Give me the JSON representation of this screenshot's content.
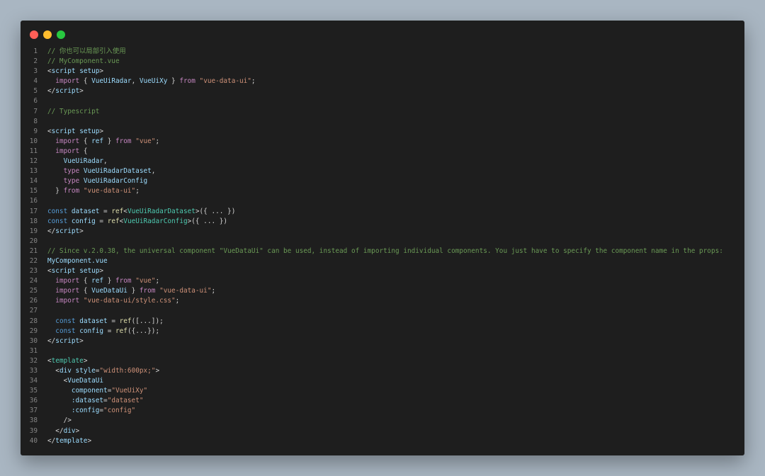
{
  "window": {
    "controls": [
      "close",
      "minimize",
      "maximize"
    ],
    "colors": {
      "close": "#ff5f57",
      "minimize": "#febc2e",
      "maximize": "#28c840",
      "background": "#1e1e1e"
    }
  },
  "lines": [
    {
      "n": "1",
      "tokens": [
        [
          "c",
          "// 你也可以局部引入使用"
        ]
      ]
    },
    {
      "n": "2",
      "tokens": [
        [
          "c",
          "// MyComponent.vue"
        ]
      ]
    },
    {
      "n": "3",
      "tokens": [
        [
          "p",
          "<"
        ],
        [
          "t",
          "script"
        ],
        [
          "p",
          " "
        ],
        [
          "a",
          "setup"
        ],
        [
          "p",
          ">"
        ]
      ]
    },
    {
      "n": "4",
      "tokens": [
        [
          "p",
          "  "
        ],
        [
          "k",
          "import"
        ],
        [
          "p",
          " { "
        ],
        [
          "t",
          "VueUiRadar"
        ],
        [
          "p",
          ", "
        ],
        [
          "t",
          "VueUiXy"
        ],
        [
          "p",
          " } "
        ],
        [
          "k",
          "from"
        ],
        [
          "p",
          " "
        ],
        [
          "s",
          "\"vue-data-ui\""
        ],
        [
          "p",
          ";"
        ]
      ]
    },
    {
      "n": "5",
      "tokens": [
        [
          "p",
          "</"
        ],
        [
          "t",
          "script"
        ],
        [
          "p",
          ">"
        ]
      ]
    },
    {
      "n": "6",
      "tokens": []
    },
    {
      "n": "7",
      "tokens": [
        [
          "c",
          "// Typescript"
        ]
      ]
    },
    {
      "n": "8",
      "tokens": []
    },
    {
      "n": "9",
      "tokens": [
        [
          "p",
          "<"
        ],
        [
          "t",
          "script"
        ],
        [
          "p",
          " "
        ],
        [
          "a",
          "setup"
        ],
        [
          "p",
          ">"
        ]
      ]
    },
    {
      "n": "10",
      "tokens": [
        [
          "p",
          "  "
        ],
        [
          "k",
          "import"
        ],
        [
          "p",
          " { "
        ],
        [
          "t",
          "ref"
        ],
        [
          "p",
          " } "
        ],
        [
          "k",
          "from"
        ],
        [
          "p",
          " "
        ],
        [
          "s",
          "\"vue\""
        ],
        [
          "p",
          ";"
        ]
      ]
    },
    {
      "n": "11",
      "tokens": [
        [
          "p",
          "  "
        ],
        [
          "k",
          "import"
        ],
        [
          "p",
          " {"
        ]
      ]
    },
    {
      "n": "12",
      "tokens": [
        [
          "p",
          "    "
        ],
        [
          "t",
          "VueUiRadar"
        ],
        [
          "p",
          ","
        ]
      ]
    },
    {
      "n": "13",
      "tokens": [
        [
          "p",
          "    "
        ],
        [
          "k",
          "type"
        ],
        [
          "p",
          " "
        ],
        [
          "t",
          "VueUiRadarDataset"
        ],
        [
          "p",
          ","
        ]
      ]
    },
    {
      "n": "14",
      "tokens": [
        [
          "p",
          "    "
        ],
        [
          "k",
          "type"
        ],
        [
          "p",
          " "
        ],
        [
          "t",
          "VueUiRadarConfig"
        ]
      ]
    },
    {
      "n": "15",
      "tokens": [
        [
          "p",
          "  } "
        ],
        [
          "k",
          "from"
        ],
        [
          "p",
          " "
        ],
        [
          "s",
          "\"vue-data-ui\""
        ],
        [
          "p",
          ";"
        ]
      ]
    },
    {
      "n": "16",
      "tokens": []
    },
    {
      "n": "17",
      "tokens": [
        [
          "b",
          "const"
        ],
        [
          "p",
          " "
        ],
        [
          "t",
          "dataset"
        ],
        [
          "p",
          " = "
        ],
        [
          "f",
          "ref"
        ],
        [
          "p",
          "<"
        ],
        [
          "ty",
          "VueUiRadarDataset"
        ],
        [
          "p",
          ">({ ... })"
        ]
      ]
    },
    {
      "n": "18",
      "tokens": [
        [
          "b",
          "const"
        ],
        [
          "p",
          " "
        ],
        [
          "t",
          "config"
        ],
        [
          "p",
          " = "
        ],
        [
          "f",
          "ref"
        ],
        [
          "p",
          "<"
        ],
        [
          "ty",
          "VueUiRadarConfig"
        ],
        [
          "p",
          ">({ ... })"
        ]
      ]
    },
    {
      "n": "19",
      "tokens": [
        [
          "p",
          "</"
        ],
        [
          "t",
          "script"
        ],
        [
          "p",
          ">"
        ]
      ]
    },
    {
      "n": "20",
      "tokens": []
    },
    {
      "n": "21",
      "tokens": [
        [
          "c",
          "// Since v.2.0.38, the universal component \"VueDataUi\" can be used, instead of importing individual components. You just have to specify the component name in the props:"
        ]
      ]
    },
    {
      "n": "22",
      "tokens": [
        [
          "t",
          "MyComponent.vue"
        ]
      ]
    },
    {
      "n": "23",
      "tokens": [
        [
          "p",
          "<"
        ],
        [
          "t",
          "script"
        ],
        [
          "p",
          " "
        ],
        [
          "a",
          "setup"
        ],
        [
          "p",
          ">"
        ]
      ]
    },
    {
      "n": "24",
      "tokens": [
        [
          "p",
          "  "
        ],
        [
          "k",
          "import"
        ],
        [
          "p",
          " { "
        ],
        [
          "t",
          "ref"
        ],
        [
          "p",
          " } "
        ],
        [
          "k",
          "from"
        ],
        [
          "p",
          " "
        ],
        [
          "s",
          "\"vue\""
        ],
        [
          "p",
          ";"
        ]
      ]
    },
    {
      "n": "25",
      "tokens": [
        [
          "p",
          "  "
        ],
        [
          "k",
          "import"
        ],
        [
          "p",
          " { "
        ],
        [
          "t",
          "VueDataUi"
        ],
        [
          "p",
          " } "
        ],
        [
          "k",
          "from"
        ],
        [
          "p",
          " "
        ],
        [
          "s",
          "\"vue-data-ui\""
        ],
        [
          "p",
          ";"
        ]
      ]
    },
    {
      "n": "26",
      "tokens": [
        [
          "p",
          "  "
        ],
        [
          "k",
          "import"
        ],
        [
          "p",
          " "
        ],
        [
          "s",
          "\"vue-data-ui/style.css\""
        ],
        [
          "p",
          ";"
        ]
      ]
    },
    {
      "n": "27",
      "tokens": []
    },
    {
      "n": "28",
      "tokens": [
        [
          "p",
          "  "
        ],
        [
          "b",
          "const"
        ],
        [
          "p",
          " "
        ],
        [
          "t",
          "dataset"
        ],
        [
          "p",
          " = "
        ],
        [
          "f",
          "ref"
        ],
        [
          "p",
          "([...]);"
        ]
      ]
    },
    {
      "n": "29",
      "tokens": [
        [
          "p",
          "  "
        ],
        [
          "b",
          "const"
        ],
        [
          "p",
          " "
        ],
        [
          "t",
          "config"
        ],
        [
          "p",
          " = "
        ],
        [
          "f",
          "ref"
        ],
        [
          "p",
          "({...});"
        ]
      ]
    },
    {
      "n": "30",
      "tokens": [
        [
          "p",
          "</"
        ],
        [
          "t",
          "script"
        ],
        [
          "p",
          ">"
        ]
      ]
    },
    {
      "n": "31",
      "tokens": []
    },
    {
      "n": "32",
      "tokens": [
        [
          "p",
          "<"
        ],
        [
          "ty",
          "template"
        ],
        [
          "p",
          ">"
        ]
      ]
    },
    {
      "n": "33",
      "tokens": [
        [
          "p",
          "  <"
        ],
        [
          "t",
          "div"
        ],
        [
          "p",
          " "
        ],
        [
          "a",
          "style"
        ],
        [
          "p",
          "="
        ],
        [
          "s",
          "\"width:600px;\""
        ],
        [
          "p",
          ">"
        ]
      ]
    },
    {
      "n": "34",
      "tokens": [
        [
          "p",
          "    <"
        ],
        [
          "t",
          "VueDataUi"
        ]
      ]
    },
    {
      "n": "35",
      "tokens": [
        [
          "p",
          "      "
        ],
        [
          "a",
          "component"
        ],
        [
          "p",
          "="
        ],
        [
          "s",
          "\"VueUiXy\""
        ]
      ]
    },
    {
      "n": "36",
      "tokens": [
        [
          "p",
          "      "
        ],
        [
          "a",
          ":dataset"
        ],
        [
          "p",
          "="
        ],
        [
          "s",
          "\"dataset\""
        ]
      ]
    },
    {
      "n": "37",
      "tokens": [
        [
          "p",
          "      "
        ],
        [
          "a",
          ":config"
        ],
        [
          "p",
          "="
        ],
        [
          "s",
          "\"config\""
        ]
      ]
    },
    {
      "n": "38",
      "tokens": [
        [
          "p",
          "    />"
        ]
      ]
    },
    {
      "n": "39",
      "tokens": [
        [
          "p",
          "  </"
        ],
        [
          "t",
          "div"
        ],
        [
          "p",
          ">"
        ]
      ]
    },
    {
      "n": "40",
      "tokens": [
        [
          "p",
          "</"
        ],
        [
          "t",
          "template"
        ],
        [
          "p",
          ">"
        ]
      ]
    }
  ]
}
